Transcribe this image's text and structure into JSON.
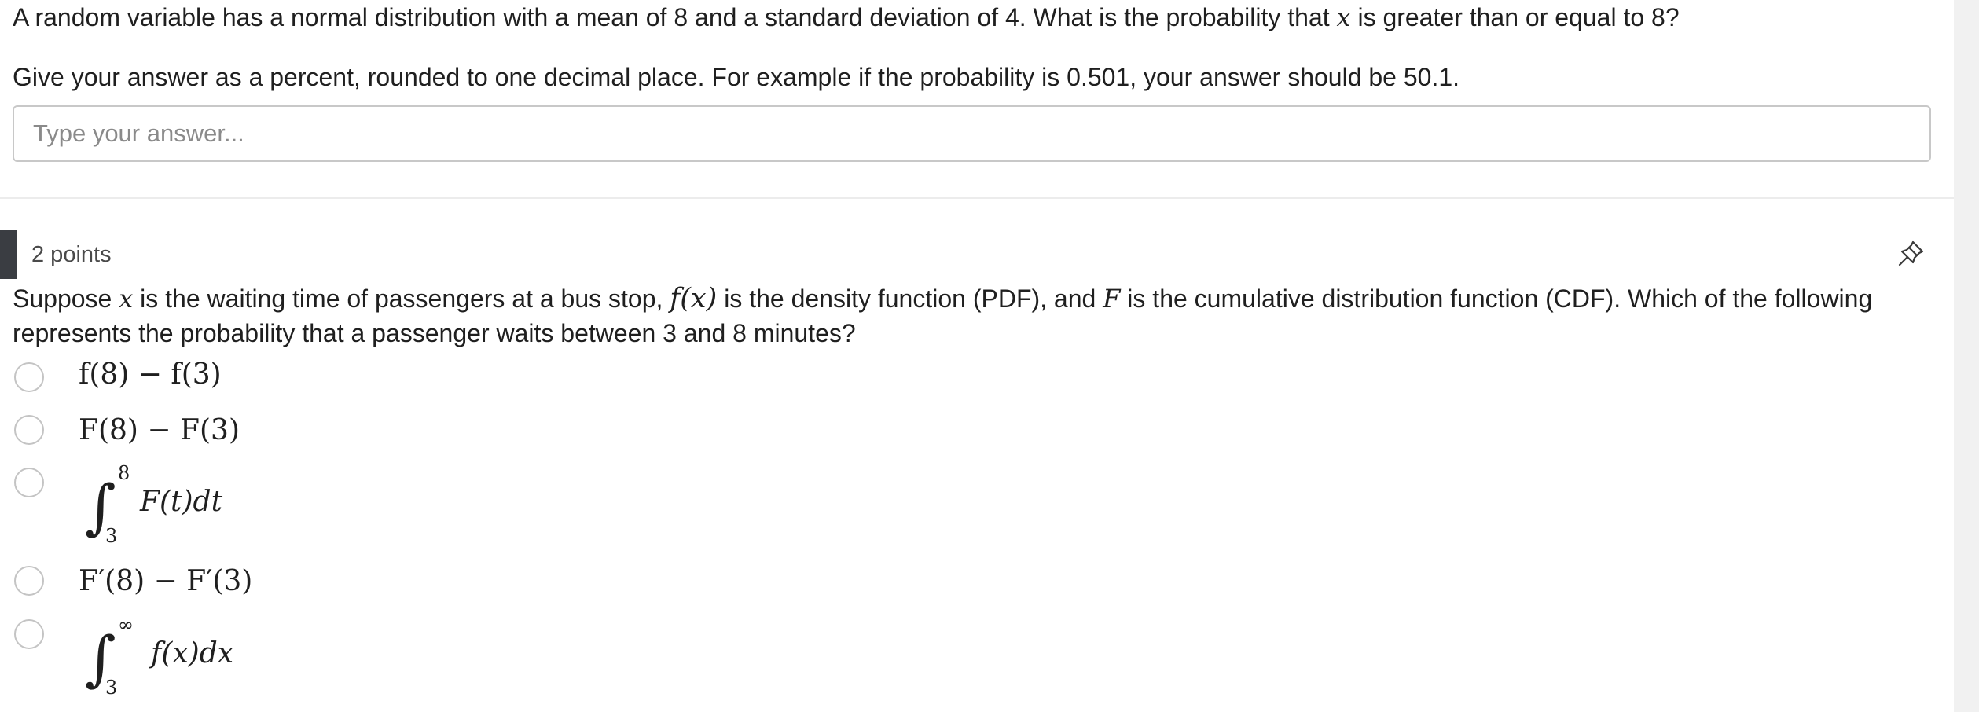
{
  "question1": {
    "text": "A random variable has a normal distribution with a mean of 8 and a standard deviation of 4.  What is the probability that ",
    "var": "x",
    "text_end": " is greater than or equal to 8?",
    "instructions": "Give your answer as a percent, rounded to one decimal place. For example if the probability is 0.501, your answer should be 50.1.",
    "answer_placeholder": "Type your answer...",
    "answer_value": ""
  },
  "question2": {
    "points": "2 points",
    "pin_icon": "pin-icon",
    "text_parts": {
      "p1": "Suppose ",
      "x": "x",
      "p2": " is the waiting time of passengers at a bus stop, ",
      "fx": "f(x)",
      "p3": " is the density function (PDF), and ",
      "F": "F",
      "p4": " is the cumulative distribution function (CDF).  Which of the following represents the probability that a passenger waits between 3 and 8 minutes?"
    },
    "choices": [
      {
        "label": "f(8) − f(3)"
      },
      {
        "label": "F(8) − F(3)"
      },
      {
        "upper": "8",
        "lower": "3",
        "body": "F(t)dt"
      },
      {
        "label": "F′(8) − F′(3)"
      },
      {
        "upper": "∞",
        "lower": "3",
        "body": "f(x)dx"
      }
    ],
    "integral_sign": "∫"
  },
  "colors": {
    "accent_bar": "#3a3d42",
    "border": "#c8c8c8",
    "placeholder": "#8a8a8a"
  }
}
